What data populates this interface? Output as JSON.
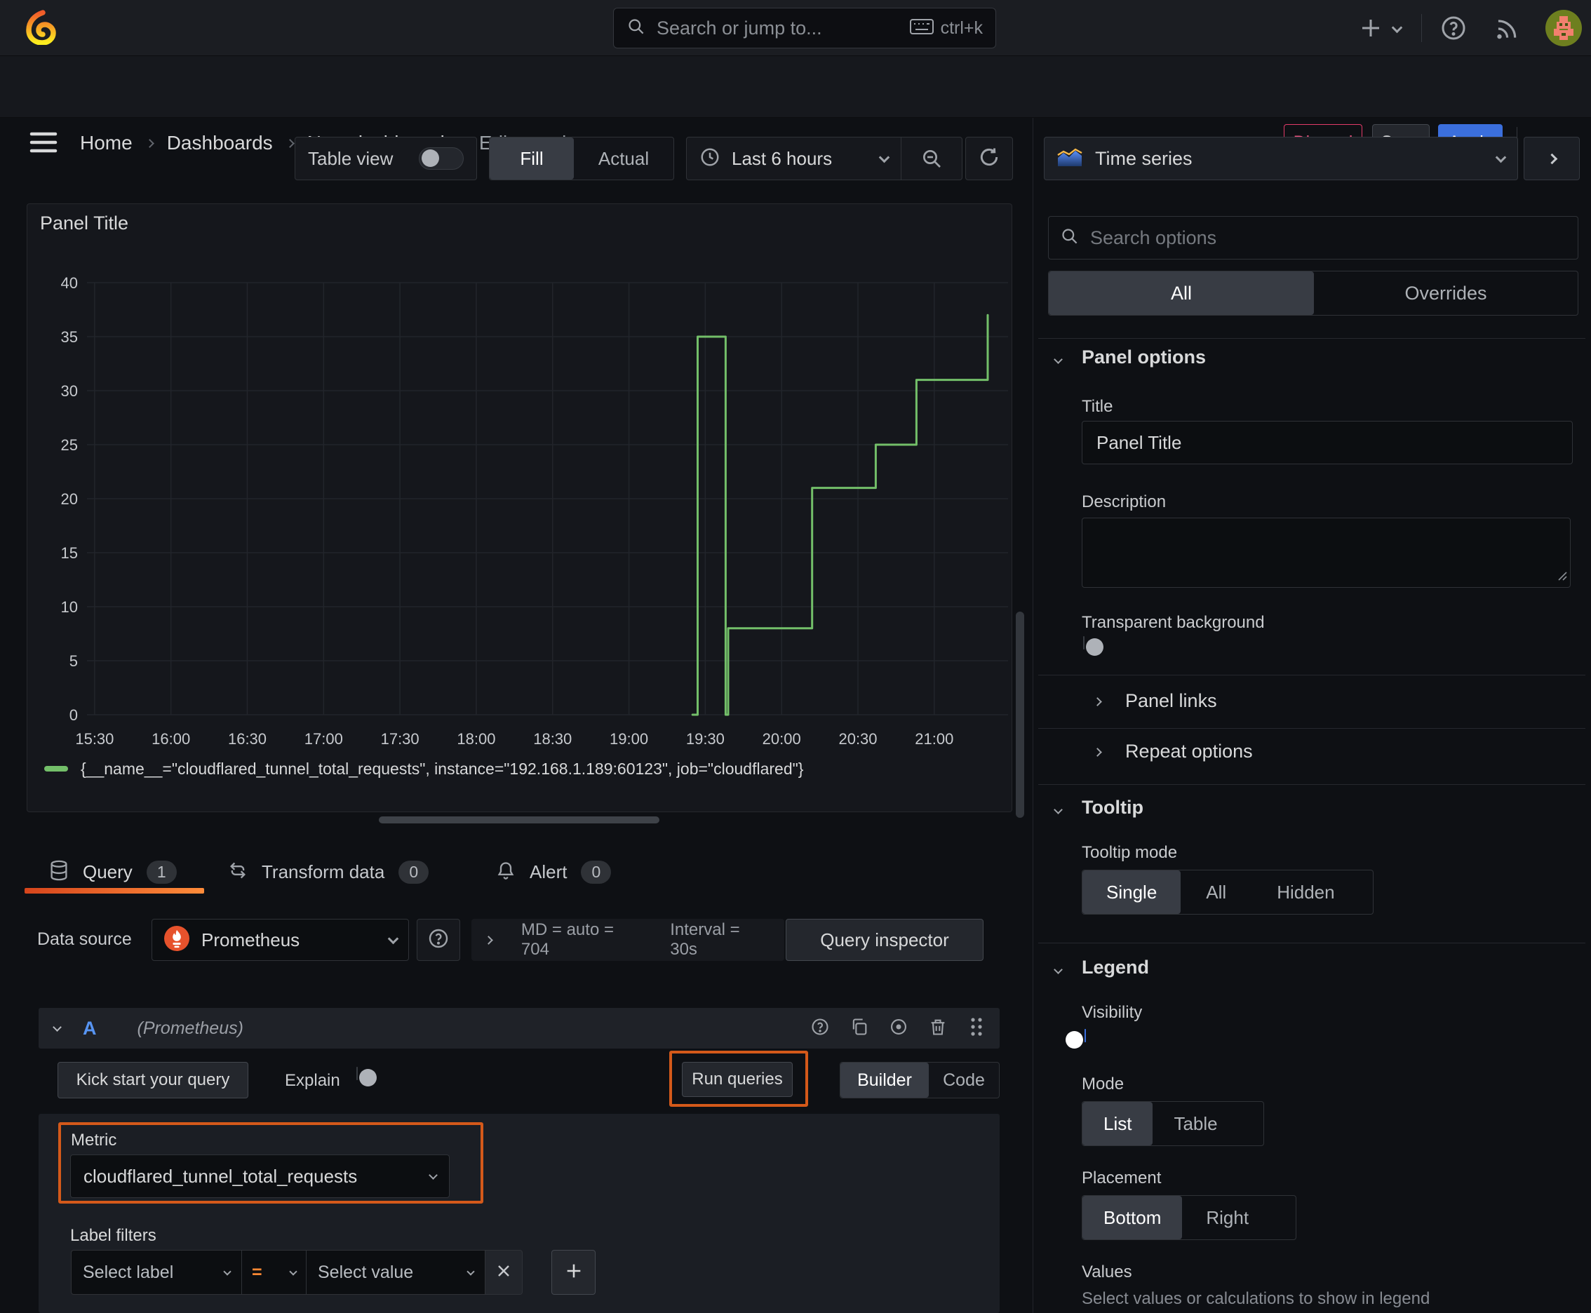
{
  "topbar": {
    "search_placeholder": "Search or jump to...",
    "shortcut": "ctrl+k"
  },
  "breadcrumb": {
    "items": [
      "Home",
      "Dashboards",
      "New dashboard",
      "Edit panel"
    ]
  },
  "actions": {
    "discard": "Discard",
    "save": "Save",
    "apply": "Apply"
  },
  "toolbar": {
    "table_view": "Table view",
    "fill": "Fill",
    "actual": "Actual",
    "time_range": "Last 6 hours"
  },
  "panel": {
    "title": "Panel Title"
  },
  "chart_data": {
    "type": "line",
    "step": true,
    "title": "Panel Title",
    "x_ticks": [
      "15:30",
      "16:00",
      "16:30",
      "17:00",
      "17:30",
      "18:00",
      "18:30",
      "19:00",
      "19:30",
      "20:00",
      "20:30",
      "21:00"
    ],
    "y_ticks": [
      0,
      5,
      10,
      15,
      20,
      25,
      30,
      35,
      40
    ],
    "x_range": [
      "15:27",
      "21:29"
    ],
    "ylim": [
      0,
      40
    ],
    "grid": true,
    "legend_position": "bottom",
    "series": [
      {
        "name": "{__name__=\"cloudflared_tunnel_total_requests\", instance=\"192.168.1.189:60123\", job=\"cloudflared\"}",
        "color": "#73bf69",
        "points": [
          [
            "19:25",
            0
          ],
          [
            "19:27",
            35
          ],
          [
            "19:37",
            35
          ],
          [
            "19:38",
            0
          ],
          [
            "19:39",
            8
          ],
          [
            "20:11",
            8
          ],
          [
            "20:12",
            21
          ],
          [
            "20:36",
            21
          ],
          [
            "20:37",
            25
          ],
          [
            "20:52",
            25
          ],
          [
            "20:53",
            31
          ],
          [
            "21:19",
            31
          ],
          [
            "21:21",
            37
          ]
        ]
      }
    ]
  },
  "tabs": {
    "query": "Query",
    "query_count": "1",
    "transform": "Transform data",
    "transform_count": "0",
    "alert": "Alert",
    "alert_count": "0"
  },
  "query": {
    "datasource_label": "Data source",
    "datasource": "Prometheus",
    "stats_md": "MD = auto = 704",
    "stats_interval": "Interval = 30s",
    "inspector": "Query inspector",
    "row_letter": "A",
    "row_ds": "(Prometheus)",
    "kickstart": "Kick start your query",
    "explain": "Explain",
    "run": "Run queries",
    "builder": "Builder",
    "code": "Code",
    "metric_label": "Metric",
    "metric_value": "cloudflared_tunnel_total_requests",
    "label_filters": "Label filters",
    "select_label": "Select label",
    "operator": "=",
    "select_value": "Select value"
  },
  "options": {
    "viz": "Time series",
    "search_placeholder": "Search options",
    "tab_all": "All",
    "tab_overrides": "Overrides",
    "panel_options": "Panel options",
    "title_label": "Title",
    "title_value": "Panel Title",
    "description_label": "Description",
    "transparent": "Transparent background",
    "panel_links": "Panel links",
    "repeat_options": "Repeat options",
    "tooltip": "Tooltip",
    "tooltip_mode": "Tooltip mode",
    "single": "Single",
    "all": "All",
    "hidden": "Hidden",
    "legend": "Legend",
    "visibility": "Visibility",
    "mode": "Mode",
    "list": "List",
    "table": "Table",
    "placement": "Placement",
    "bottom": "Bottom",
    "right": "Right",
    "values": "Values",
    "values_help": "Select values or calculations to show in legend"
  },
  "colors": {
    "accent_orange": "#ff8833",
    "annotation_orange": "#d4591a",
    "apply_blue": "#3b6fdd",
    "discard_pink": "#e8527e",
    "series_green": "#73bf69",
    "toggle_on_blue": "#3b6fdd"
  }
}
